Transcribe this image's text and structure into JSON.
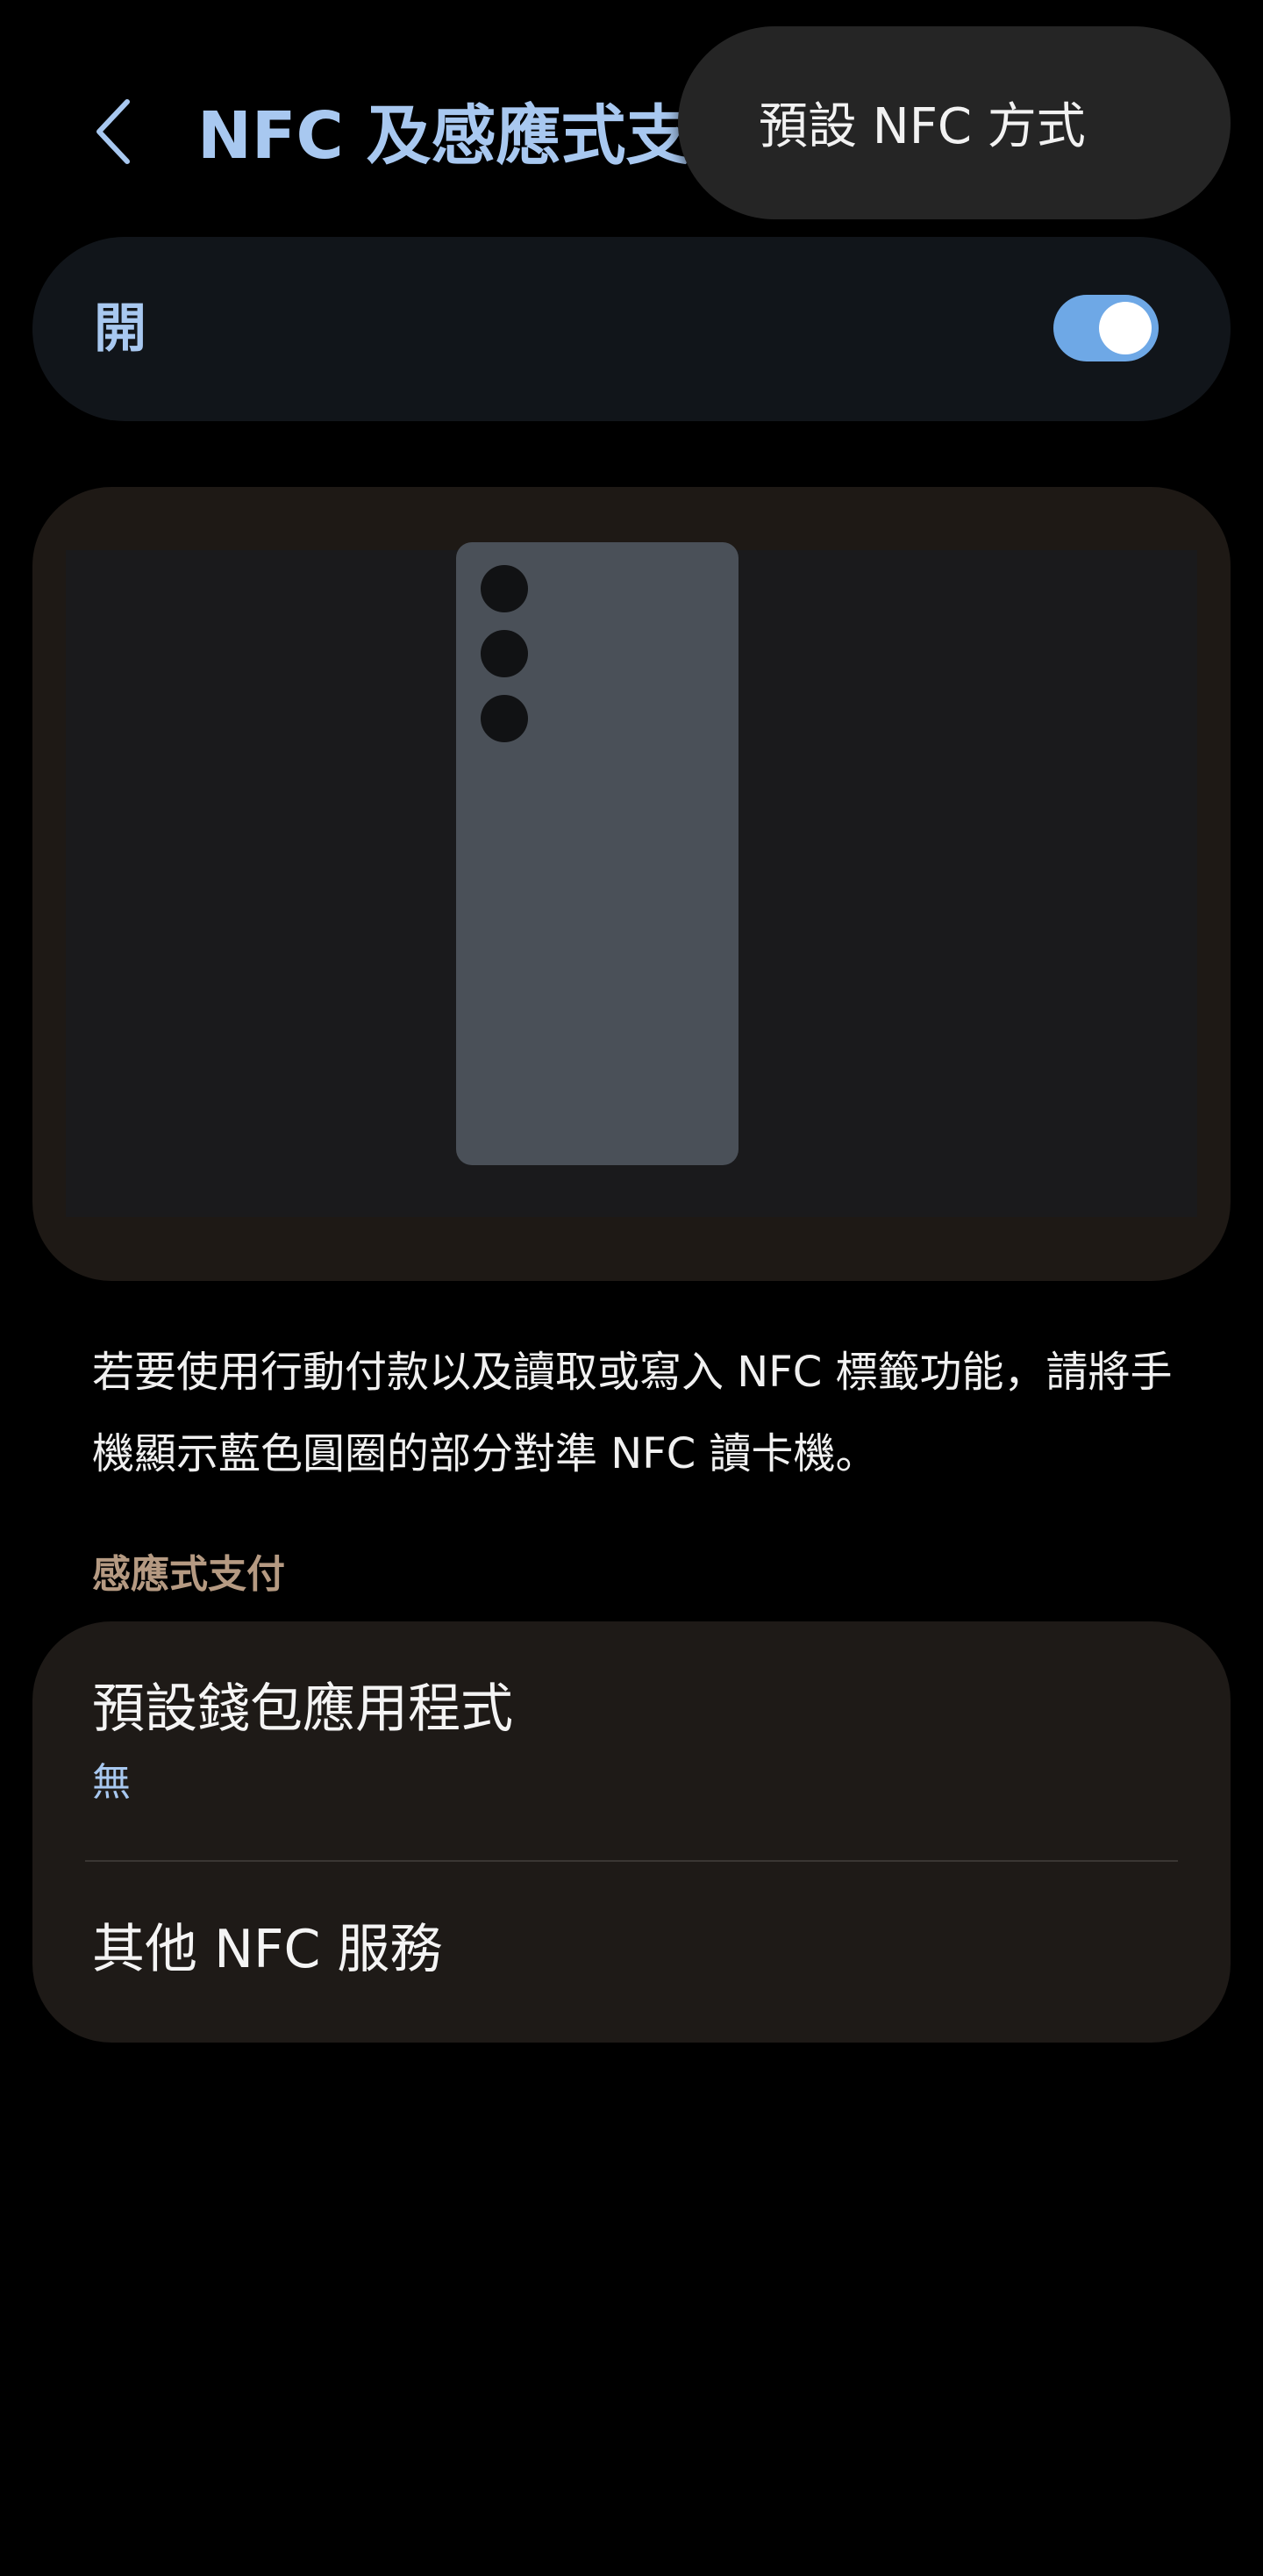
{
  "header": {
    "title": "NFC 及感應式支",
    "back_icon": "back-arrow-icon"
  },
  "popup_menu": {
    "items": [
      {
        "label": "預設 NFC 方式"
      }
    ]
  },
  "master_switch": {
    "label": "開",
    "state": "on",
    "accent_color": "#6ea8e6"
  },
  "illustration": {
    "icon": "phone-back-with-cameras"
  },
  "description": "若要使用行動付款以及讀取或寫入 NFC 標籤功能，請將手機顯示藍色圓圈的部分對準 NFC 讀卡機。",
  "section": {
    "title": "感應式支付"
  },
  "list": {
    "items": [
      {
        "title": "預設錢包應用程式",
        "subtitle": "無"
      },
      {
        "title": "其他 NFC 服務"
      }
    ]
  },
  "colors": {
    "title_blue": "#a8c8f0",
    "section_brown": "#b59a82",
    "background": "#000000"
  }
}
